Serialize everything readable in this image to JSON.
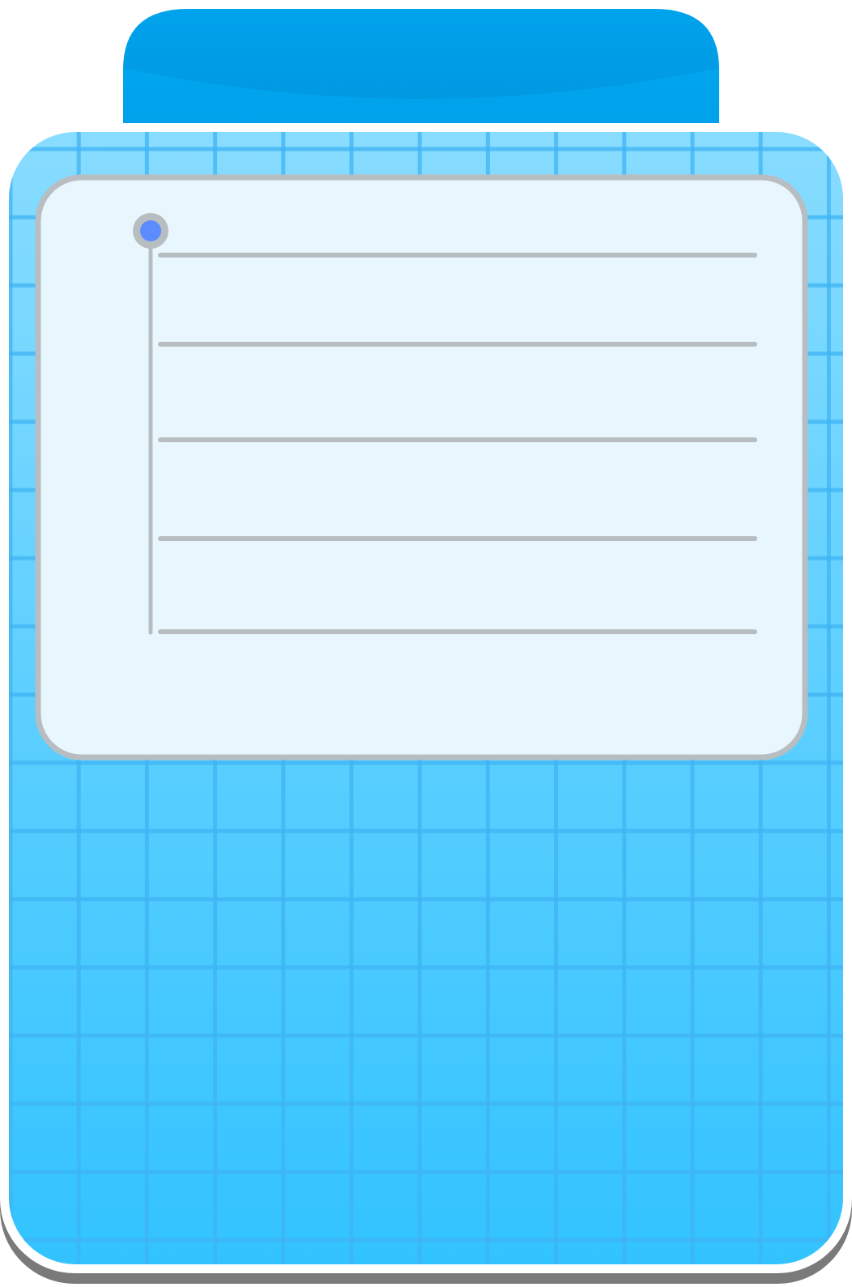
{
  "illustration": {
    "kind": "clipboard-notepad",
    "colors": {
      "lid_top": "#00A3EC",
      "lid_bottom": "#0096DF",
      "lid_band": "#00B6FF",
      "board_top": "#88DCFF",
      "board_bottom": "#32C3FF",
      "grid_line": "#3FB4F4",
      "frame_white": "#FFFFFF",
      "shadow": "#7A7A7A",
      "card_fill": "#E8F6FE",
      "card_border": "#B8BDC1",
      "rule_line": "#B8BDC1",
      "pin_ring": "#B8BDC1",
      "pin_dot": "#5C8CFF"
    },
    "card": {
      "ruled_line_count": 5,
      "has_pin": true,
      "has_margin_line": true
    },
    "grid": {
      "columns": 12,
      "rows": 17
    }
  }
}
